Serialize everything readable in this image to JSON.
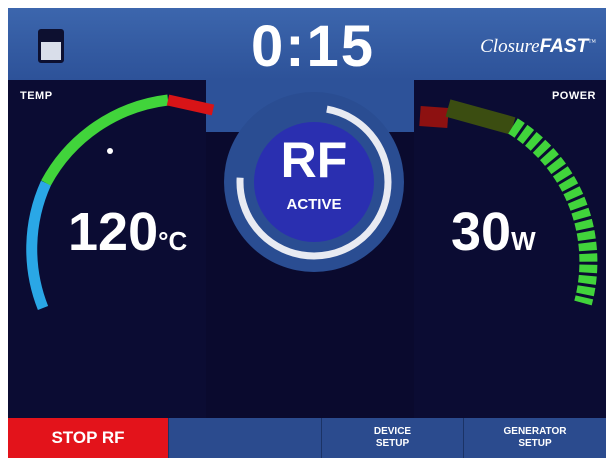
{
  "header": {
    "timer": "0:15",
    "brand_prefix": "Closure",
    "brand_suffix": "FAST",
    "brand_mark": "™",
    "battery_icon": "battery-icon"
  },
  "temp": {
    "label": "TEMP",
    "value": "120",
    "unit_deg": "°",
    "unit": "C"
  },
  "power": {
    "label": "POWER",
    "value": "30",
    "unit": "W"
  },
  "rf": {
    "title": "RF",
    "status": "ACTIVE"
  },
  "footer": {
    "stop": "STOP RF",
    "device_setup": "DEVICE\nSETUP",
    "generator_setup": "GENERATOR\nSETUP"
  },
  "colors": {
    "stop_bg": "#e3131b",
    "gauge_green": "#41d43b",
    "gauge_red": "#d81417",
    "gauge_blue": "#2aa7e6"
  }
}
